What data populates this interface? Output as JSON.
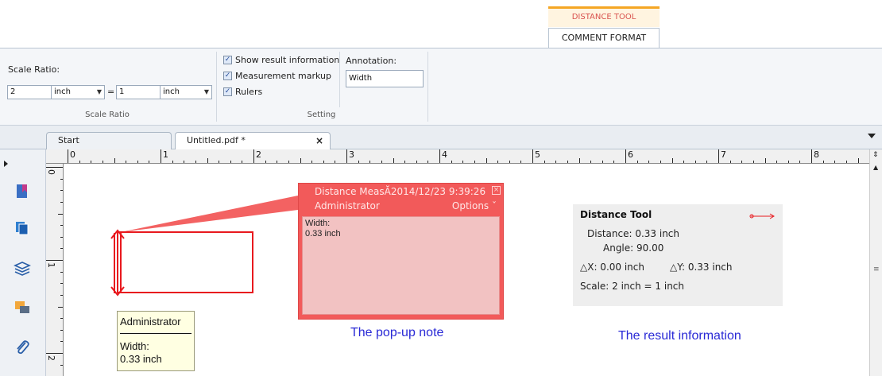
{
  "ribbon": {
    "context_tab": "DISTANCE TOOL",
    "active_tab": "COMMENT FORMAT",
    "scale_ratio": {
      "label": "Scale Ratio:",
      "left_value": "2",
      "left_unit": "inch",
      "equals": "=",
      "right_value": "1",
      "right_unit": "inch",
      "group_label": "Scale Ratio"
    },
    "setting": {
      "show_result_info": "Show result information",
      "measurement_markup": "Measurement markup",
      "rulers": "Rulers",
      "show_result_info_checked": true,
      "measurement_markup_checked": true,
      "rulers_checked": true,
      "group_label": "Setting"
    },
    "annotation": {
      "label": "Annotation:",
      "value": "Width"
    }
  },
  "tabs": [
    {
      "label": "Start"
    },
    {
      "label": "Untitled.pdf *"
    }
  ],
  "ruler": {
    "top_numbers": [
      "0",
      "1",
      "2",
      "3",
      "4",
      "5",
      "6",
      "7",
      "8"
    ],
    "left_numbers": [
      "0",
      "1",
      "2"
    ]
  },
  "popup": {
    "title": "Distance MeasĂ2014/12/23 9:39:26",
    "author": "Administrator",
    "options": "Options ˇ",
    "body_line1": "Width:",
    "body_line2": "0.33 inch"
  },
  "admin_note": {
    "title": "Administrator",
    "line1": "Width:",
    "line2": "0.33 inch"
  },
  "result": {
    "title": "Distance Tool",
    "distance": "Distance:  0.33 inch",
    "angle": "Angle:  90.00",
    "dx": "△X: 0.00 inch",
    "dy": "△Y: 0.33 inch",
    "scale": "Scale:  2 inch = 1 inch"
  },
  "captions": {
    "popup": "The pop-up note",
    "result": "The result information"
  },
  "colors": {
    "markup": "#e8191e",
    "popup_bg": "#f25a5a",
    "popup_body": "#f2c2c2",
    "caption": "#2a2ad6",
    "context_tab": "#d9534f"
  },
  "icons": {
    "bookmark": "bookmark-icon",
    "pages": "pages-icon",
    "layers": "layers-icon",
    "comments": "comments-icon",
    "attachments": "paperclip-icon"
  }
}
